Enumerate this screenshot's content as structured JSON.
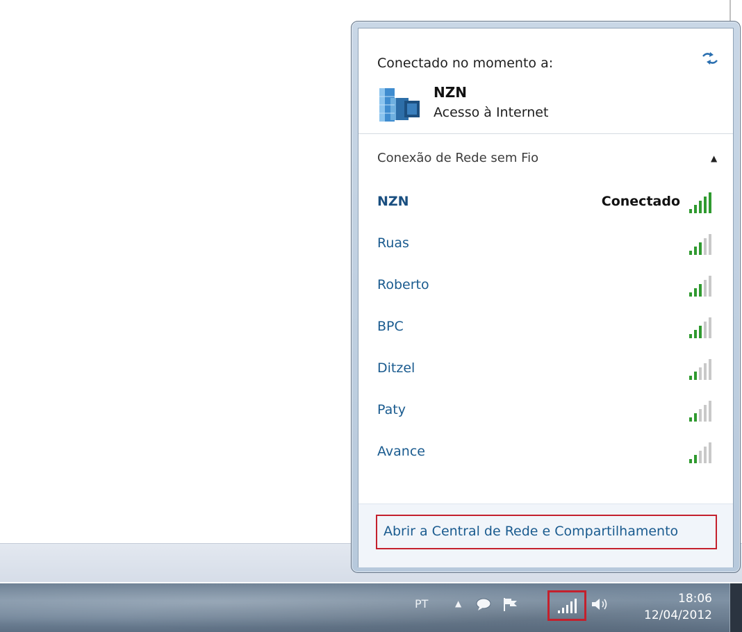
{
  "flyout": {
    "current_header": "Conectado no momento a:",
    "current_network": {
      "name": "NZN",
      "access": "Acesso à Internet",
      "icon": "network-building-icon"
    },
    "refresh_icon": "refresh-icon",
    "section_title": "Conexão de Rede sem Fio",
    "networks": [
      {
        "name": "NZN",
        "status": "Conectado",
        "signal_bars": 5
      },
      {
        "name": "Ruas",
        "status": "",
        "signal_bars": 3
      },
      {
        "name": "Roberto",
        "status": "",
        "signal_bars": 3
      },
      {
        "name": "BPC",
        "status": "",
        "signal_bars": 3
      },
      {
        "name": "Ditzel",
        "status": "",
        "signal_bars": 2
      },
      {
        "name": "Paty",
        "status": "",
        "signal_bars": 2
      },
      {
        "name": "Avance",
        "status": "",
        "signal_bars": 2
      }
    ],
    "open_center_link": "Abrir a Central de Rede e Compartilhamento"
  },
  "taskbar": {
    "language": "PT",
    "time": "18:06",
    "date": "12/04/2012",
    "icons": [
      "show-hidden-icons-arrow",
      "action-center-bubble-icon",
      "action-center-flag-icon",
      "network-signal-icon",
      "volume-icon"
    ]
  },
  "colors": {
    "link": "#1a5b8f",
    "signal_green": "#2f9a2f",
    "highlight_red": "#c4202c"
  }
}
